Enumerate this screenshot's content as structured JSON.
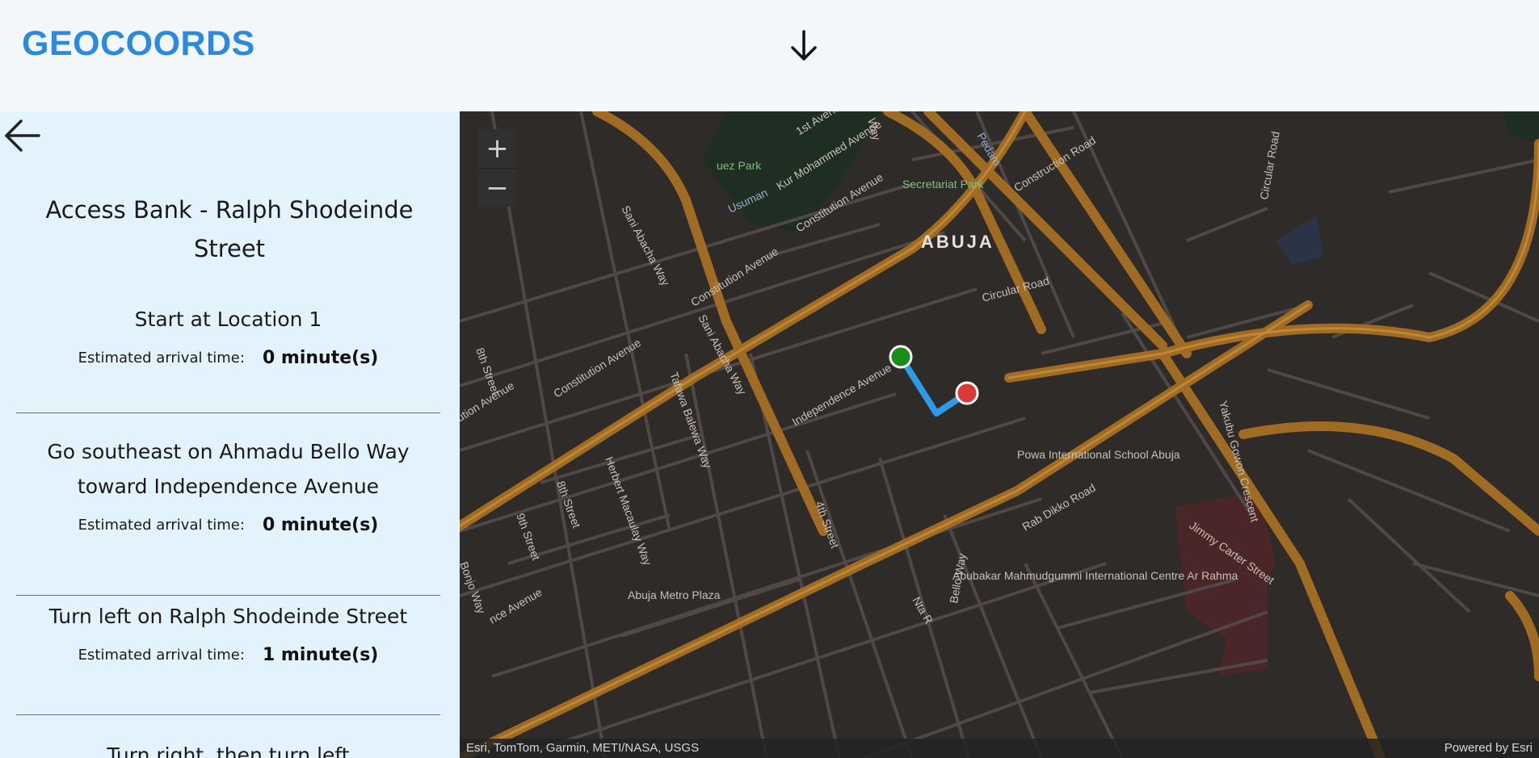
{
  "header": {
    "logo": "GEOCOORDS"
  },
  "panel": {
    "destination_title": "Access Bank - Ralph Shodeinde Street",
    "eta_label": "Estimated arrival time:",
    "steps": [
      {
        "instruction": "Start at Location 1",
        "eta": "0 minute(s)"
      },
      {
        "instruction": "Go southeast on Ahmadu Bello Way toward Independence Avenue",
        "eta": "0 minute(s)"
      },
      {
        "instruction": "Turn left on Ralph Shodeinde Street",
        "eta": "1 minute(s)"
      },
      {
        "instruction": "Turn right, then turn left"
      }
    ]
  },
  "map": {
    "zoom_in": "+",
    "zoom_out": "−",
    "city_label": "ABUJA",
    "labels": {
      "secretariat_park": "Secretariat Park",
      "construction_road": "Construction Road",
      "circular_road": "Circular Road",
      "circular_road_v": "Circular Road",
      "constitution_avenue_1": "Constitution Avenue",
      "constitution_avenue_2": "Constitution Avenue",
      "constitution_avenue_3": "Constitution Avenue",
      "constitution_avenue_4": "Constitution Avenue",
      "independence_avenue": "Independence Avenue",
      "sani_abacha_way_1": "Sani Abacha Way",
      "sani_abacha_way_2": "Sani Abacha Way",
      "kur_mohammed_avenue": "Kur Mohammed Avenue",
      "first_avenue": "1st Avenue",
      "usuman": "Usuman",
      "pedam": "Pedam",
      "uez_park": "uez Park",
      "eighth_street_1": "8th Street",
      "eighth_street_2": "8th Street",
      "ninth_street": "9th Street",
      "tafawa_balewa_way": "Tafawa Balewa Way",
      "herbert_macaulay_way": "Herbert Macaulay Way",
      "fourth_street": "4th Street",
      "powa_school": "Powa International School Abuja",
      "rab_dikko_road": "Rab Dikko Road",
      "abubakar_centre": "Abubakar Mahmudgummi International Centre Ar Rahma",
      "jimmy_carter_street": "Jimmy Carter Street",
      "yakubu_gowon_crescent": "Yakubu Gowon Crescent",
      "abuja_metro_plaza": "Abuja Metro Plaza",
      "ahmadu_bello_way": "Bello Way",
      "nta_road": "Nta R",
      "nce_avenue": "nce Avenue",
      "bonjo_way": "Bonjo Way",
      "ution_avenue": "ution Avenue",
      "way_top": "Way"
    },
    "start_color": "#1a8c1a",
    "end_color": "#d83a3a",
    "route_color": "#2d9be8",
    "attribution_left": "Esri, TomTom, Garmin, METI/NASA, USGS",
    "attribution_right": "Powered by Esri"
  }
}
